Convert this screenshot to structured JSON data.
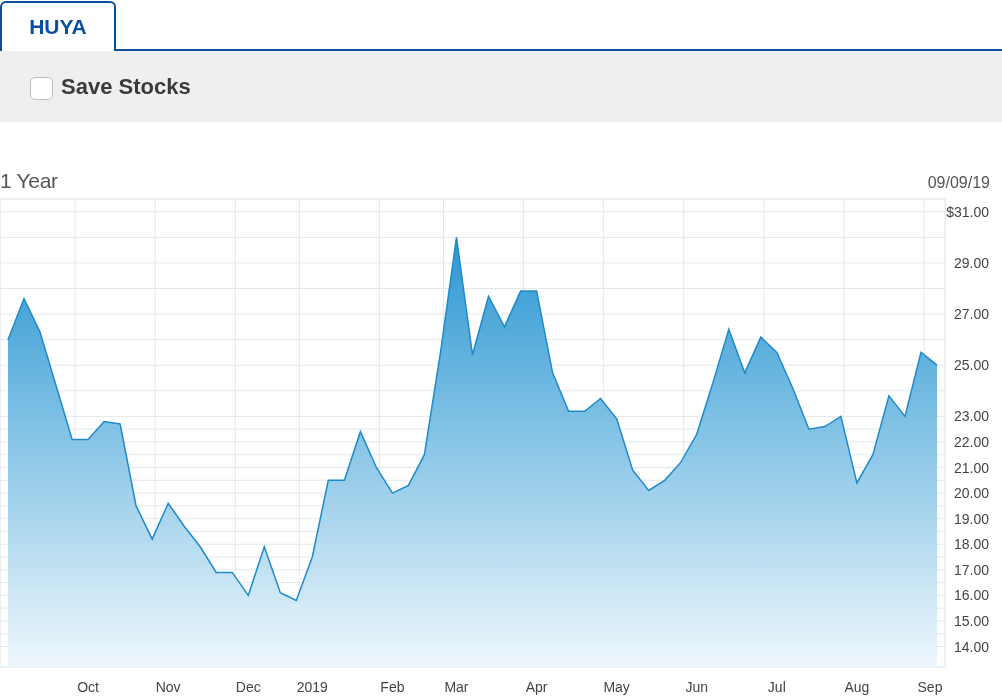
{
  "tabs": [
    {
      "label": "HUYA",
      "selected": true
    }
  ],
  "save_stocks": {
    "label": "Save Stocks",
    "checked": false
  },
  "chart": {
    "range_label": "1 Year",
    "date": "09/09/19",
    "chart_data": {
      "type": "area",
      "grid": true,
      "ylim": [
        13.2,
        31.5
      ],
      "categories": [
        null,
        null,
        null,
        null,
        null,
        "Oct",
        null,
        null,
        null,
        null,
        "Nov",
        null,
        null,
        null,
        null,
        "Dec",
        null,
        null,
        null,
        "2019",
        null,
        null,
        null,
        null,
        "Feb",
        null,
        null,
        null,
        "Mar",
        null,
        null,
        null,
        null,
        "Apr",
        null,
        null,
        null,
        null,
        "May",
        null,
        null,
        null,
        null,
        "Jun",
        null,
        null,
        null,
        null,
        "Jul",
        null,
        null,
        null,
        null,
        "Aug",
        null,
        null,
        null,
        null,
        "Sep"
      ],
      "yticks": [
        {
          "value": 31,
          "label": "$31.00"
        },
        {
          "value": 29,
          "label": "29.00"
        },
        {
          "value": 27,
          "label": "27.00"
        },
        {
          "value": 25,
          "label": "25.00"
        },
        {
          "value": 23,
          "label": "23.00"
        },
        {
          "value": 22,
          "label": "22.00"
        },
        {
          "value": 21,
          "label": "21.00"
        },
        {
          "value": 20,
          "label": "20.00"
        },
        {
          "value": 19,
          "label": "19.00"
        },
        {
          "value": 18,
          "label": "18.00"
        },
        {
          "value": 17,
          "label": "17.00"
        },
        {
          "value": 16,
          "label": "16.00"
        },
        {
          "value": 15,
          "label": "15.00"
        },
        {
          "value": 14,
          "label": "14.00"
        }
      ],
      "series": [
        {
          "color": "#1e8ac9",
          "values": [
            26.0,
            27.6,
            26.3,
            24.2,
            22.1,
            22.1,
            22.8,
            22.7,
            19.5,
            18.2,
            19.6,
            18.7,
            17.9,
            16.9,
            16.9,
            16.0,
            17.9,
            16.1,
            15.8,
            17.5,
            20.5,
            20.5,
            22.4,
            21.0,
            20.0,
            20.3,
            21.5,
            25.5,
            30.0,
            25.4,
            27.7,
            26.5,
            27.9,
            27.9,
            24.7,
            23.2,
            23.2,
            23.7,
            22.9,
            20.9,
            20.1,
            20.5,
            21.2,
            22.3,
            24.3,
            26.4,
            24.7,
            26.1,
            25.5,
            24.1,
            22.5,
            22.6,
            23.0,
            20.4,
            21.5,
            23.8,
            23.0,
            25.5,
            25.0
          ]
        }
      ]
    }
  }
}
